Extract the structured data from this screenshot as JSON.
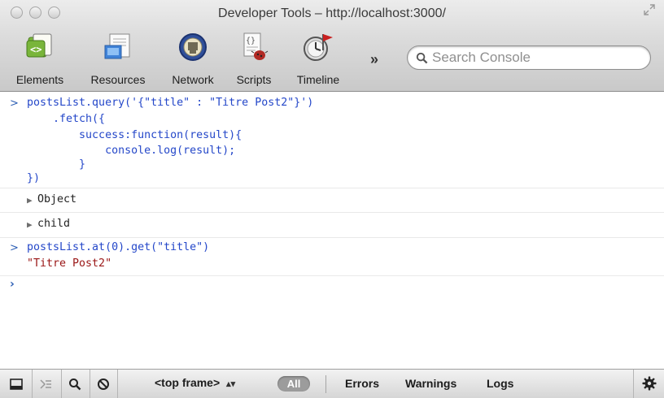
{
  "window": {
    "title": "Developer Tools – http://localhost:3000/"
  },
  "toolbar": {
    "items": [
      {
        "label": "Elements",
        "icon": "elements-icon"
      },
      {
        "label": "Resources",
        "icon": "resources-icon"
      },
      {
        "label": "Network",
        "icon": "network-icon"
      },
      {
        "label": "Scripts",
        "icon": "scripts-icon"
      },
      {
        "label": "Timeline",
        "icon": "timeline-icon"
      }
    ],
    "overflow": "»",
    "search_placeholder": "Search Console"
  },
  "console": {
    "command1": [
      "postsList.query('{\"title\" : \"Titre Post2\"}')",
      "    .fetch({",
      "        success:function(result){",
      "            console.log(result);",
      "        }",
      "})"
    ],
    "results1": [
      "Object",
      "child"
    ],
    "command2": "postsList.at(0).get(\"title\")",
    "result2": "\"Titre Post2\"",
    "prompt": ">",
    "input_prompt": "›"
  },
  "statusbar": {
    "frame": "<top frame>",
    "filter_all": "All",
    "filters": [
      "Errors",
      "Warnings",
      "Logs"
    ]
  },
  "colors": {
    "command": "#2447c9",
    "string": "#9a1616",
    "prompt": "#2d5fb5"
  }
}
